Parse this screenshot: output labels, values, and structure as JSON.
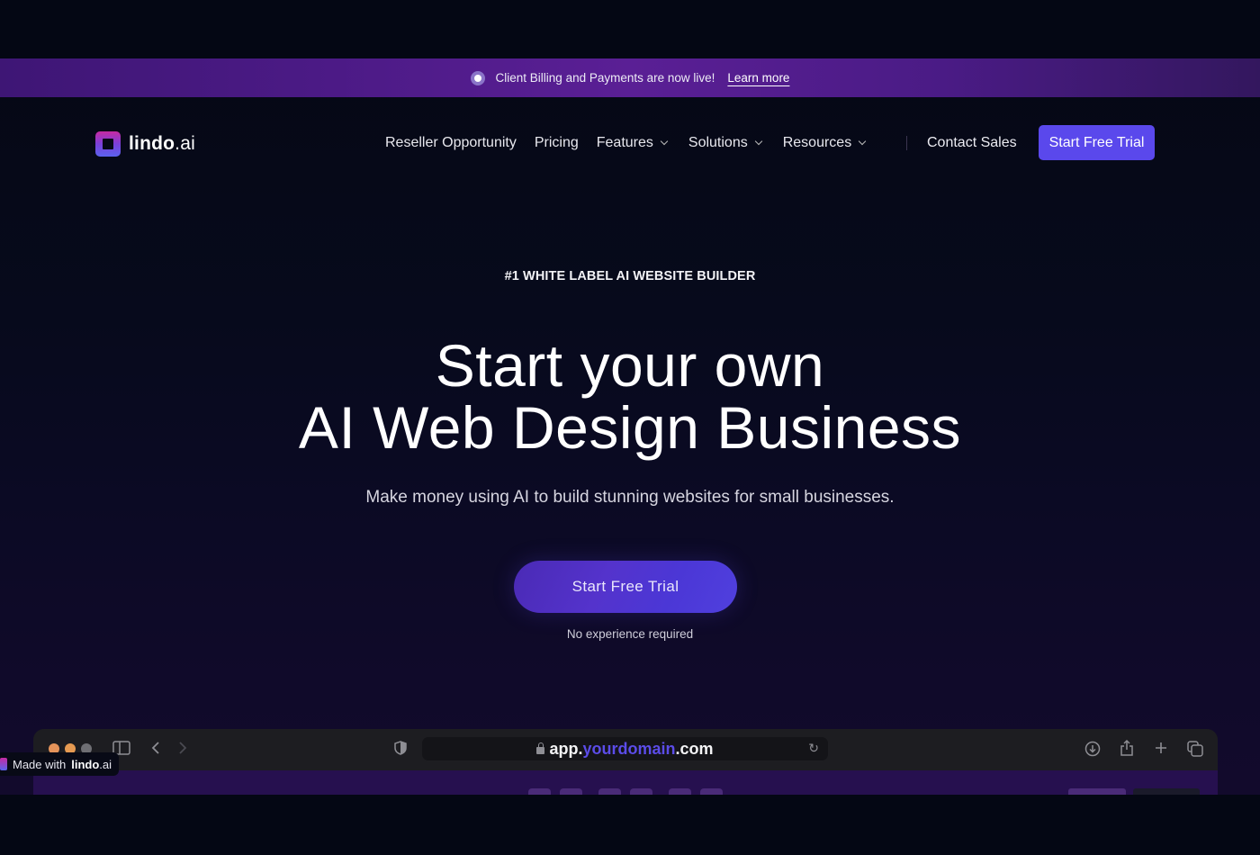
{
  "announcement": {
    "icon": "radio-dot-icon",
    "text": "Client Billing and Payments are now live!",
    "link_label": "Learn more"
  },
  "nav": {
    "logo": {
      "bold": "lindo",
      "light": ".ai"
    },
    "links": [
      {
        "label": "Reseller Opportunity",
        "has_dropdown": false
      },
      {
        "label": "Pricing",
        "has_dropdown": false
      },
      {
        "label": "Features",
        "has_dropdown": true
      },
      {
        "label": "Solutions",
        "has_dropdown": true
      },
      {
        "label": "Resources",
        "has_dropdown": true
      }
    ],
    "contact_label": "Contact Sales",
    "cta_label": "Start Free Trial"
  },
  "hero": {
    "eyebrow": "#1 WHITE LABEL AI WEBSITE BUILDER",
    "headline_line1": "Start your own",
    "headline_line2": "AI Web Design Business",
    "subheadline": "Make money using AI to build stunning websites for small businesses.",
    "cta_label": "Start Free Trial",
    "note": "No experience required"
  },
  "browser_mockup": {
    "url_prefix": "app.",
    "url_domain": "yourdomain",
    "url_suffix": ".com",
    "icons": [
      "sidebar-icon",
      "back-icon",
      "forward-icon",
      "shield-icon",
      "reload-icon",
      "download-icon",
      "share-icon",
      "new-tab-icon",
      "tabs-icon"
    ]
  },
  "badge": {
    "prefix": "Made with",
    "bold": "lindo",
    "light": ".ai"
  },
  "colors": {
    "accent": "#5a48ec",
    "announcement_bg": "#5a1f95",
    "page_bg": "#050815",
    "url_highlight": "#5b4ce8"
  }
}
